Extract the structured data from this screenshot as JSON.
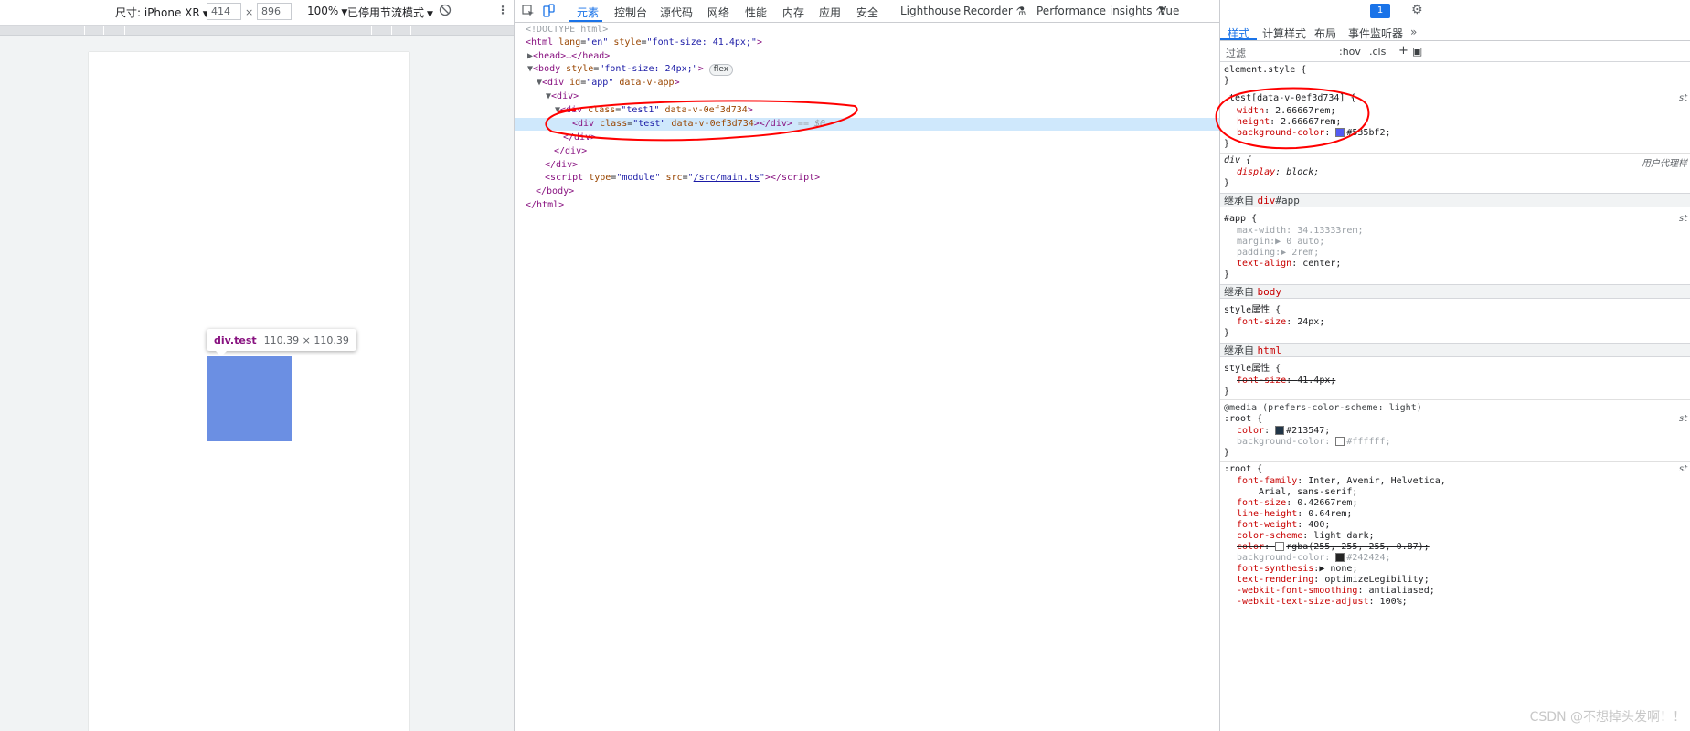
{
  "device_toolbar": {
    "dimensions_label": "尺寸: iPhone XR",
    "width": "414",
    "times": "×",
    "height": "896",
    "zoom": "100%",
    "throttle": "已停用节流模式"
  },
  "tooltip": {
    "name": "div.test",
    "size": "110.39 × 110.39"
  },
  "main_tabs": [
    "元素",
    "控制台",
    "源代码",
    "网络",
    "性能",
    "内存",
    "应用",
    "安全",
    "Lighthouse",
    "Recorder",
    "Performance insights",
    "Vue"
  ],
  "issues_count": "1",
  "dom": {
    "doctype": "<!DOCTYPE html>",
    "html_open_tag": "<html",
    "html_lang_attr": "lang",
    "html_lang_val": "\"en\"",
    "html_style_attr": "style",
    "html_style_val": "\"font-size: 41.4px;\"",
    "head": "<head>…</head>",
    "body_open": "<body",
    "body_style_val": "\"font-size: 24px;\"",
    "flex_badge": "flex",
    "app_open": "<div",
    "app_id_val": "\"app\"",
    "app_attr": "data-v-app",
    "div_open": "<div>",
    "test1_class_val": "\"test1\"",
    "scoped_attr": "data-v-0ef3d734",
    "test_class_val": "\"test\"",
    "eq_dollar": "== $0",
    "div_close": "</div>",
    "script_type_val": "\"module\"",
    "script_src": "/src/main.ts",
    "body_close": "</body>",
    "html_close": "</html>"
  },
  "styles_tabs": [
    "样式",
    "计算样式",
    "布局",
    "事件监听器"
  ],
  "filter_placeholder": "过滤",
  "filter_tools": {
    "hov": ":hov",
    "cls": ".cls",
    "plus": "+"
  },
  "rules": {
    "element_style": "element.style {",
    "test_selector": ".test[data-v-0ef3d734] {",
    "test_width": "2.66667rem;",
    "test_height": "2.66667rem;",
    "test_bg": "#535bf2;",
    "div_selector": "div {",
    "div_origin": "用户代理样",
    "div_display": "block;",
    "inherit1": "继承自",
    "inherit1_tag": "div",
    "inherit1_id": "#app",
    "app_selector": "#app {",
    "app_maxwidth": "34.13333rem;",
    "app_margin": "0 auto;",
    "app_padding": "2rem;",
    "app_textalign": "center;",
    "inherit2": "继承自",
    "inherit2_tag": "body",
    "style_attr_sel": "style属性 {",
    "body_fontsize": "24px;",
    "inherit3": "继承自",
    "inherit3_tag": "html",
    "html_fontsize": "41.4px;",
    "media": "@media (prefers-color-scheme: light)",
    "root1": ":root {",
    "root1_color": "#213547;",
    "root1_bg": "#ffffff;",
    "root2": ":root {",
    "ff": "Inter, Avenir, Helvetica,",
    "ff2": "Arial, sans-serif;",
    "fs": "0.42667rem;",
    "lh": "0.64rem;",
    "fw": "400;",
    "cs": "light dark;",
    "color2": "rgba(255, 255, 255, 0.87);",
    "bg2": "#242424;",
    "fsyn": "none;",
    "tr": "optimizeLegibility;",
    "wfs": "antialiased;",
    "wtsa": "100%;",
    "st": "st"
  },
  "watermark": "CSDN @不想掉头发啊！！",
  "colors": {
    "accent": "#1a73e8",
    "test_bg": "#535bf2",
    "root_color": "#213547",
    "bg_dark": "#242424",
    "annotation": "#ff0000"
  }
}
